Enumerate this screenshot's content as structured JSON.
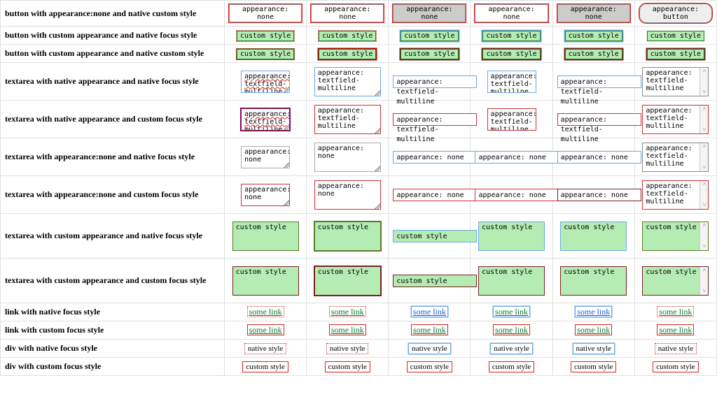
{
  "labels": {
    "r1": "button with appearance:none and native custom style",
    "r2": "button with custom appearance and native focus style",
    "r3": "button with custom appearance and native custom style",
    "r4": "textarea with native appearance and native focus style",
    "r5": "textarea with native appearance and custom focus style",
    "r6": "textarea with appearance:none and native focus style",
    "r7": "textarea with appearance:none and custom focus style",
    "r8": "textarea with custom appearance and native focus style",
    "r9": "textarea with custom appearance and custom focus style",
    "r10": "link with native focus style",
    "r11": "link with custom focus style",
    "r12": "div with native focus style",
    "r13": "div with custom focus style"
  },
  "btn": {
    "apn": "appearance: none",
    "apb": "appearance: button",
    "cs": "custom style"
  },
  "ta": {
    "tfm": "appearance: textfield-multiline",
    "tfm_break": "appearance:\ntextfield-\nmultiline",
    "an": "appearance: none",
    "an_break": "appearance:\nnone",
    "cs": "custom style"
  },
  "link": {
    "txt": "some link"
  },
  "div": {
    "native": "native style",
    "custom": "custom style"
  }
}
